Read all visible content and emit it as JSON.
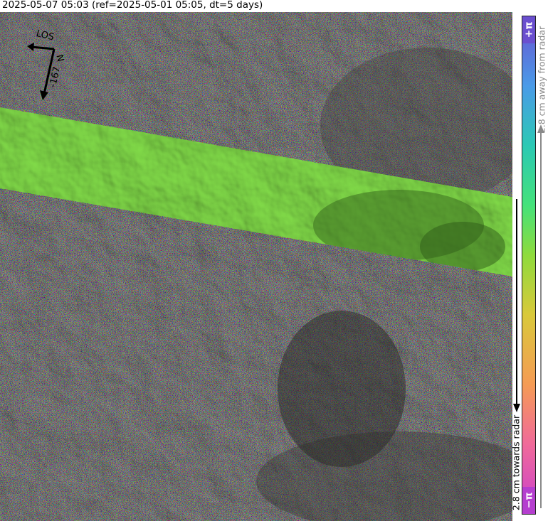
{
  "header": {
    "title": "2025-05-07 05:03 (ref=2025-05-01 05:05, dt=5 days)"
  },
  "compass": {
    "los_label": "LOS",
    "north_label": "N",
    "heading_label": "-167"
  },
  "colorbar": {
    "top_label": "+π",
    "bottom_label": "−π",
    "away_label": "2.8 cm away from radar",
    "towards_label": "2.8 cm towards radar",
    "colors": [
      "#c93fcf",
      "#f06a9a",
      "#f59b55",
      "#d9c93b",
      "#8fdb3c",
      "#45e27a",
      "#2bc9b4",
      "#4a9be8",
      "#6a4fcf"
    ]
  },
  "map": {
    "coherent_swath_color": "#84e04a",
    "noise_palette": [
      "#c23ac7",
      "#e8568f",
      "#e89a3f",
      "#c9c72f",
      "#55cf48",
      "#28c2b0",
      "#3c88e0",
      "#7a4fd0",
      "#9a9a94"
    ]
  }
}
